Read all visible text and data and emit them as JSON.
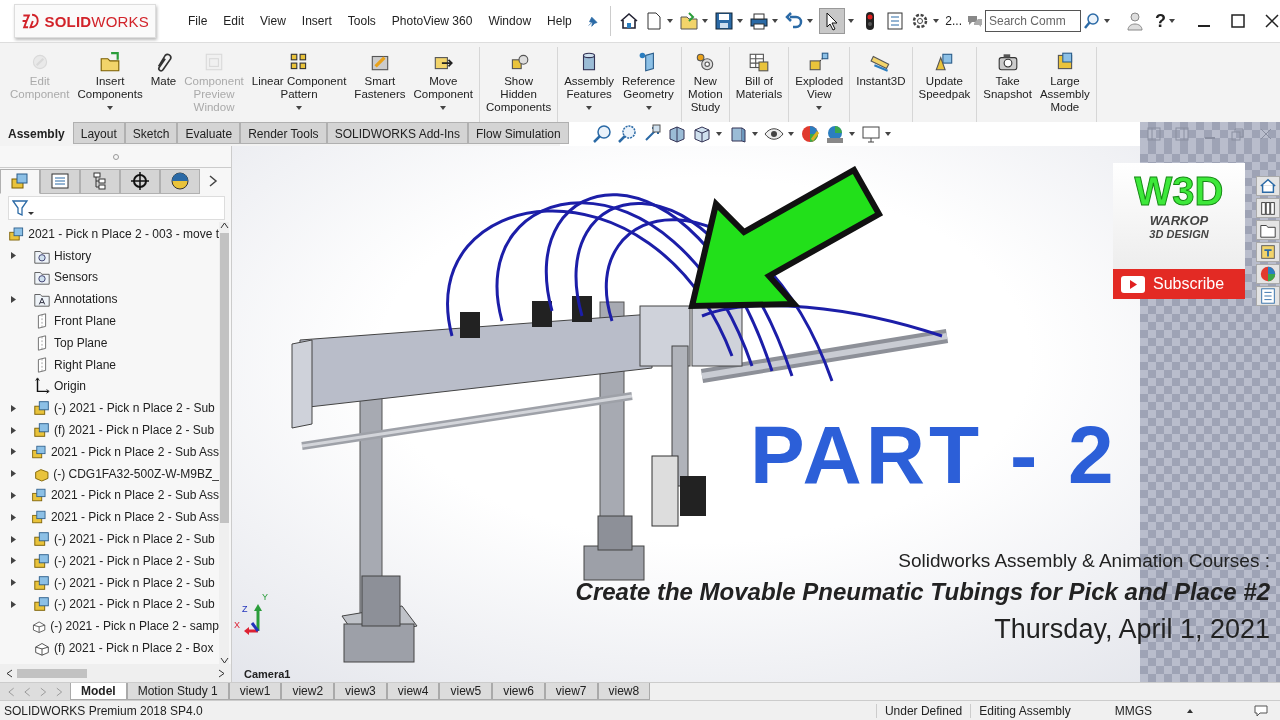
{
  "app": {
    "logo": "**SOLID**WORKS",
    "menu": [
      "File",
      "Edit",
      "View",
      "Insert",
      "Tools",
      "PhotoView 360",
      "Window",
      "Help"
    ]
  },
  "quick_access": [
    {
      "kind": "home",
      "pressed": false
    },
    {
      "kind": "new",
      "pressed": false
    },
    {
      "kind": "open",
      "pressed": false
    },
    {
      "kind": "save",
      "pressed": false
    },
    {
      "kind": "print",
      "pressed": false
    },
    {
      "kind": "undo",
      "pressed": false
    },
    {
      "kind": "select",
      "pressed": true
    },
    {
      "kind": "rebuild",
      "pressed": false
    },
    {
      "kind": "file-properties",
      "pressed": false
    },
    {
      "kind": "options",
      "pressed": false
    }
  ],
  "configuration": "2...",
  "search": {
    "placeholder": "Search Comm"
  },
  "help": "?",
  "ribbon": [
    {
      "buttons": [
        {
          "lines": [
            "Edit",
            "Component"
          ],
          "kind": "edit",
          "disabled": true,
          "dropdown": false
        },
        {
          "lines": [
            "Insert",
            "Components"
          ],
          "kind": "insert",
          "disabled": false,
          "dropdown": true
        },
        {
          "lines": [
            "Mate"
          ],
          "kind": "mate",
          "disabled": false,
          "dropdown": false
        },
        {
          "lines": [
            "Component",
            "Preview",
            "Window"
          ],
          "kind": "preview",
          "disabled": true,
          "dropdown": false
        },
        {
          "lines": [
            "Linear Component",
            "Pattern"
          ],
          "kind": "pattern",
          "disabled": false,
          "dropdown": true
        },
        {
          "lines": [
            "Smart",
            "Fasteners"
          ],
          "kind": "fastener",
          "disabled": false,
          "dropdown": false
        },
        {
          "lines": [
            "Move",
            "Component"
          ],
          "kind": "move",
          "disabled": false,
          "dropdown": true
        }
      ]
    },
    {
      "buttons": [
        {
          "lines": [
            "Show",
            "Hidden",
            "Components"
          ],
          "kind": "show",
          "disabled": false,
          "dropdown": false
        }
      ]
    },
    {
      "buttons": [
        {
          "lines": [
            "Assembly",
            "Features"
          ],
          "kind": "features",
          "disabled": false,
          "dropdown": true
        },
        {
          "lines": [
            "Reference",
            "Geometry"
          ],
          "kind": "reference",
          "disabled": false,
          "dropdown": true
        }
      ]
    },
    {
      "buttons": [
        {
          "lines": [
            "New",
            "Motion",
            "Study"
          ],
          "kind": "motion",
          "disabled": false,
          "dropdown": false
        }
      ]
    },
    {
      "buttons": [
        {
          "lines": [
            "Bill of",
            "Materials"
          ],
          "kind": "bom",
          "disabled": false,
          "dropdown": false
        }
      ]
    },
    {
      "buttons": [
        {
          "lines": [
            "Exploded",
            "View"
          ],
          "kind": "exploded",
          "disabled": false,
          "dropdown": true
        }
      ]
    },
    {
      "buttons": [
        {
          "lines": [
            "Instant3D"
          ],
          "kind": "instant3d",
          "disabled": false,
          "dropdown": false
        }
      ]
    },
    {
      "buttons": [
        {
          "lines": [
            "Update",
            "Speedpak"
          ],
          "kind": "speedpak",
          "disabled": false,
          "dropdown": false
        }
      ]
    },
    {
      "buttons": [
        {
          "lines": [
            "Take",
            "Snapshot"
          ],
          "kind": "snapshot",
          "disabled": false,
          "dropdown": false
        },
        {
          "lines": [
            "Large",
            "Assembly",
            "Mode"
          ],
          "kind": "large",
          "disabled": false,
          "dropdown": false
        }
      ]
    }
  ],
  "command_tabs": [
    {
      "label": "Assembly",
      "selected": true
    },
    {
      "label": "Layout",
      "selected": false
    },
    {
      "label": "Sketch",
      "selected": false
    },
    {
      "label": "Evaluate",
      "selected": false
    },
    {
      "label": "Render Tools",
      "selected": false
    },
    {
      "label": "SOLIDWORKS Add-Ins",
      "selected": false
    },
    {
      "label": "Flow Simulation",
      "selected": false
    }
  ],
  "panel_tabs": [
    {
      "kind": "feature-tree",
      "selected": true
    },
    {
      "kind": "property",
      "selected": false
    },
    {
      "kind": "configuration",
      "selected": false
    },
    {
      "kind": "dimxpert",
      "selected": false
    },
    {
      "kind": "display",
      "selected": false
    }
  ],
  "tree": {
    "label": "2021 - Pick n Place 2 - 003 - move t",
    "children": [
      {
        "label": "History",
        "kind": "history",
        "expandable": true
      },
      {
        "label": "Sensors",
        "kind": "sensors",
        "expandable": false
      },
      {
        "label": "Annotations",
        "kind": "annotations",
        "expandable": true
      },
      {
        "label": "Front Plane",
        "kind": "plane",
        "expandable": false
      },
      {
        "label": "Top Plane",
        "kind": "plane",
        "expandable": false
      },
      {
        "label": "Right Plane",
        "kind": "plane",
        "expandable": false
      },
      {
        "label": "Origin",
        "kind": "origin",
        "expandable": false
      },
      {
        "label": "(-) 2021 - Pick n Place 2 - Sub",
        "kind": "assembly",
        "expandable": true
      },
      {
        "label": "(f) 2021 - Pick n Place 2 - Sub",
        "kind": "assembly",
        "expandable": true
      },
      {
        "label": "2021 - Pick n Place 2 - Sub Ass",
        "kind": "assembly",
        "expandable": true
      },
      {
        "label": "(-) CDG1FA32-500Z-W-M9BZ_",
        "kind": "subpart",
        "expandable": true
      },
      {
        "label": "2021 - Pick n Place 2 - Sub Ass",
        "kind": "assembly",
        "expandable": true
      },
      {
        "label": "2021 - Pick n Place 2 - Sub Ass",
        "kind": "assembly",
        "expandable": true
      },
      {
        "label": "(-) 2021 - Pick n Place 2 - Sub",
        "kind": "assembly",
        "expandable": true
      },
      {
        "label": "(-) 2021 - Pick n Place 2 - Sub",
        "kind": "assembly",
        "expandable": true
      },
      {
        "label": "(-) 2021 - Pick n Place 2 - Sub",
        "kind": "assembly",
        "expandable": true
      },
      {
        "label": "(-) 2021 - Pick n Place 2 - Sub",
        "kind": "assembly",
        "expandable": true
      },
      {
        "label": "(-) 2021 - Pick n Place 2 - samp",
        "kind": "part",
        "expandable": false
      },
      {
        "label": "(f) 2021 - Pick n Place 2 - Box",
        "kind": "part",
        "expandable": false
      }
    ]
  },
  "viewport": {
    "camera_label": "Camera1",
    "triad": {
      "x": "X",
      "y": "Y",
      "z": "Z"
    },
    "overlay": {
      "part": "PART - 2",
      "course": "Solidworks Assembly & Animation Courses :",
      "title": "Create the Movable Pneumatic Tubings for Pick and Place #2",
      "date": "Thursday, April 1, 2021"
    }
  },
  "channel_badge": {
    "logo": "W3D",
    "name": "WARKOP",
    "tagline": "3D DESIGN",
    "subscribe": "Subscribe"
  },
  "bottom_tabs": [
    {
      "label": "Model",
      "selected": true
    },
    {
      "label": "Motion Study 1",
      "selected": false
    },
    {
      "label": "view1",
      "selected": false
    },
    {
      "label": "view2",
      "selected": false
    },
    {
      "label": "view3",
      "selected": false
    },
    {
      "label": "view4",
      "selected": false
    },
    {
      "label": "view5",
      "selected": false
    },
    {
      "label": "view6",
      "selected": false
    },
    {
      "label": "view7",
      "selected": false
    },
    {
      "label": "view8",
      "selected": false
    }
  ],
  "status_bar": {
    "product": "SOLIDWORKS Premium 2018 SP4.0",
    "state": "Under Defined",
    "mode": "Editing Assembly",
    "units": "MMGS"
  }
}
